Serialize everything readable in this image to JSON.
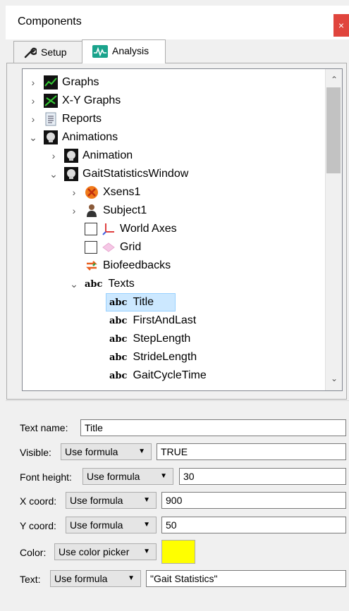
{
  "window": {
    "title": "Components",
    "close": "×"
  },
  "tabs": [
    {
      "label": "Setup",
      "icon": "wrench-icon",
      "active": false
    },
    {
      "label": "Analysis",
      "icon": "analysis-icon",
      "active": true
    }
  ],
  "tree": {
    "items": [
      {
        "label": "Graphs",
        "icon": "graph-icon",
        "expander": "›"
      },
      {
        "label": "X-Y Graphs",
        "icon": "xy-graph-icon",
        "expander": "›"
      },
      {
        "label": "Reports",
        "icon": "report-icon",
        "expander": "›"
      },
      {
        "label": "Animations",
        "icon": "skull-icon",
        "expander": "⌄"
      },
      {
        "label": "Animation",
        "icon": "skull-icon",
        "expander": "›"
      },
      {
        "label": "GaitStatisticsWindow",
        "icon": "skull-icon",
        "expander": "⌄"
      },
      {
        "label": "Xsens1",
        "icon": "xsens-icon",
        "expander": "›"
      },
      {
        "label": "Subject1",
        "icon": "person-icon",
        "expander": "›"
      },
      {
        "label": "World Axes",
        "icon": "axes-icon"
      },
      {
        "label": "Grid",
        "icon": "grid-icon"
      },
      {
        "label": "Biofeedbacks",
        "icon": "biofeedback-icon"
      },
      {
        "label": "Texts",
        "icon": "abc-icon",
        "expander": "⌄"
      },
      {
        "label": "Title",
        "icon": "abc-icon"
      },
      {
        "label": "FirstAndLast",
        "icon": "abc-icon"
      },
      {
        "label": "StepLength",
        "icon": "abc-icon"
      },
      {
        "label": "StrideLength",
        "icon": "abc-icon"
      },
      {
        "label": "GaitCycleTime",
        "icon": "abc-icon"
      }
    ],
    "abc_glyph": "abc",
    "scroll_up": "⌃",
    "scroll_down": "⌄"
  },
  "properties": {
    "text_name": {
      "label": "Text name:",
      "value": "Title"
    },
    "visible": {
      "label": "Visible:",
      "mode": "Use formula",
      "value": "TRUE"
    },
    "font_height": {
      "label": "Font height:",
      "mode": "Use formula",
      "value": "30"
    },
    "x_coord": {
      "label": "X coord:",
      "mode": "Use formula",
      "value": "900"
    },
    "y_coord": {
      "label": "Y coord:",
      "mode": "Use formula",
      "value": "50"
    },
    "color": {
      "label": "Color:",
      "mode": "Use color picker",
      "swatch": "#ffff00"
    },
    "text": {
      "label": "Text:",
      "mode": "Use formula",
      "value": "\"Gait Statistics\""
    }
  }
}
